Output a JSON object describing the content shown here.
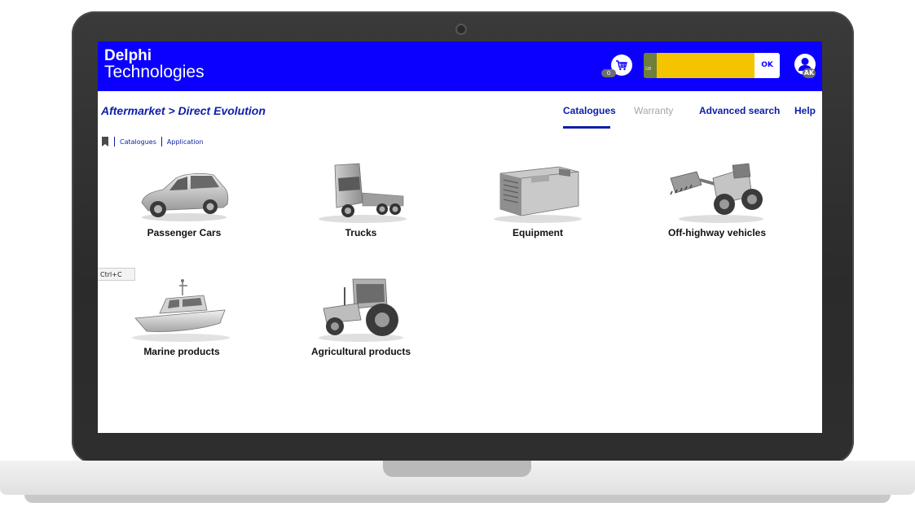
{
  "header": {
    "logo_line1": "Delphi",
    "logo_line2": "Technologies",
    "cart_count": "0",
    "search_prefix": "GB",
    "search_button": "OK",
    "user_initials": "AK"
  },
  "breadcrumb": "Aftermarket > Direct Evolution",
  "nav": {
    "catalogues": "Catalogues",
    "warranty": "Warranty",
    "advanced_search": "Advanced search",
    "help": "Help"
  },
  "subnav": {
    "catalogues": "Catalogues",
    "application": "Application"
  },
  "tiles": [
    {
      "label": "Passenger Cars",
      "icon": "car-icon"
    },
    {
      "label": "Trucks",
      "icon": "truck-icon"
    },
    {
      "label": "Equipment",
      "icon": "generator-icon"
    },
    {
      "label": "Off-highway vehicles",
      "icon": "loader-icon"
    },
    {
      "label": "Marine products",
      "icon": "boat-icon"
    },
    {
      "label": "Agricultural products",
      "icon": "tractor-icon"
    }
  ],
  "tooltip": "Ctrl+C",
  "colors": {
    "brand_blue": "#0b00ff",
    "link_blue": "#0b1ea8",
    "search_yellow": "#f5c400"
  }
}
